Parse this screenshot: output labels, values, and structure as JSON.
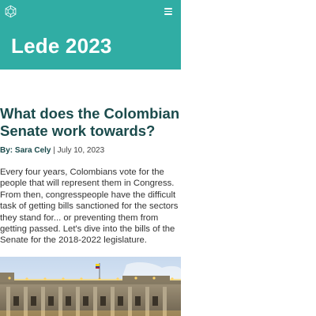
{
  "site": {
    "logo_icon": "hexagon-molecule-icon",
    "menu_icon": "hamburger-menu-icon",
    "hero_title": "Lede 2023",
    "accent_color": "#30ada4",
    "heading_color": "#1b4b4c"
  },
  "article": {
    "title": "What does the Colombian Senate work towards?",
    "byline_label": "By:",
    "author": "Sara Cely",
    "separator": "|",
    "date": "July 10, 2023",
    "intro": "Every four years, Colombians vote for the people that will represent them in Congress. From then, congresspeople have the difficult task of getting bills sanctioned for the sectors they stand for... or preventing them from getting passed. Let's dive into the bills of the Senate for the 2018-2022 legislature.",
    "image_subject": "Colombian Capitol building at dusk with Colombian flag"
  }
}
